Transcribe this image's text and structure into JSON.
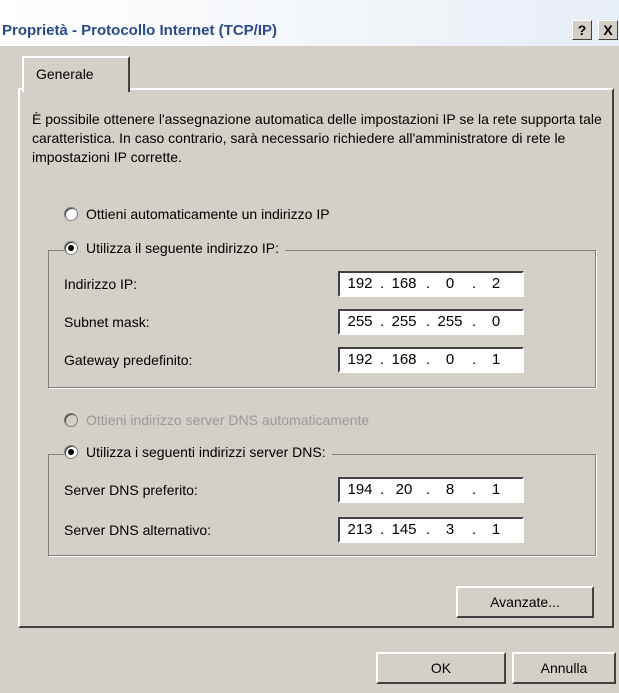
{
  "window": {
    "title": "Proprietà - Protocollo Internet (TCP/IP)",
    "help": "?",
    "close": "X"
  },
  "tab": {
    "label": "Generale"
  },
  "intro": "È possibile ottenere l'assegnazione automatica delle impostazioni IP se la rete supporta tale caratteristica. In caso contrario, sarà necessario richiedere all'amministratore di rete le impostazioni IP corrette.",
  "ip": {
    "auto_label": "Ottieni automaticamente un indirizzo IP",
    "manual_label": "Utilizza il seguente indirizzo IP:",
    "selected": "manual",
    "fields": [
      {
        "label": "Indirizzo IP:",
        "value": [
          "192",
          "168",
          "0",
          "2"
        ]
      },
      {
        "label": "Subnet mask:",
        "value": [
          "255",
          "255",
          "255",
          "0"
        ]
      },
      {
        "label": "Gateway predefinito:",
        "value": [
          "192",
          "168",
          "0",
          "1"
        ]
      }
    ]
  },
  "dns": {
    "auto_label": "Ottieni indirizzo server DNS automaticamente",
    "manual_label": "Utilizza i seguenti indirizzi server DNS:",
    "selected": "manual",
    "fields": [
      {
        "label": "Server DNS preferito:",
        "value": [
          "194",
          "20",
          "8",
          "1"
        ]
      },
      {
        "label": "Server DNS alternativo:",
        "value": [
          "213",
          "145",
          "3",
          "1"
        ]
      }
    ]
  },
  "buttons": {
    "advanced": "Avanzate...",
    "ok": "OK",
    "cancel": "Annulla"
  }
}
